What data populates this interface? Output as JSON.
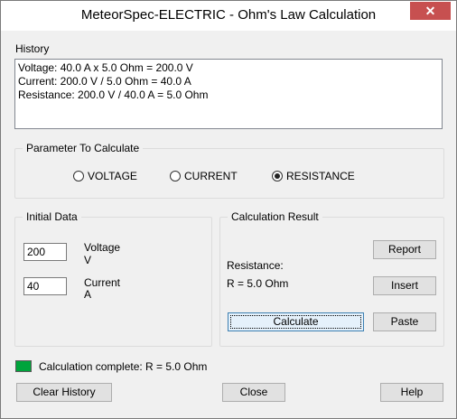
{
  "window": {
    "title": "MeteorSpec-ELECTRIC - Ohm's Law Calculation",
    "close_symbol": "✕"
  },
  "history": {
    "label": "History",
    "lines": [
      "Voltage: 40.0 A x 5.0 Ohm = 200.0 V",
      "Current: 200.0 V / 5.0 Ohm = 40.0 A",
      "Resistance: 200.0 V / 40.0 A = 5.0 Ohm"
    ]
  },
  "parameter": {
    "label": "Parameter To Calculate",
    "options": [
      {
        "label": "VOLTAGE",
        "selected": false
      },
      {
        "label": "CURRENT",
        "selected": false
      },
      {
        "label": "RESISTANCE",
        "selected": true
      }
    ]
  },
  "initial_data": {
    "label": "Initial Data",
    "voltage": {
      "value": "200",
      "name": "Voltage",
      "unit": "V"
    },
    "current": {
      "value": "40",
      "name": "Current",
      "unit": "A"
    }
  },
  "result": {
    "label": "Calculation Result",
    "name": "Resistance:",
    "value": "R = 5.0 Ohm",
    "buttons": {
      "report": "Report",
      "insert": "Insert",
      "calculate": "Calculate",
      "paste": "Paste"
    }
  },
  "status": {
    "text": "Calculation complete: R = 5.0 Ohm",
    "color": "#00a43c"
  },
  "footer": {
    "clear": "Clear History",
    "close": "Close",
    "help": "Help"
  }
}
